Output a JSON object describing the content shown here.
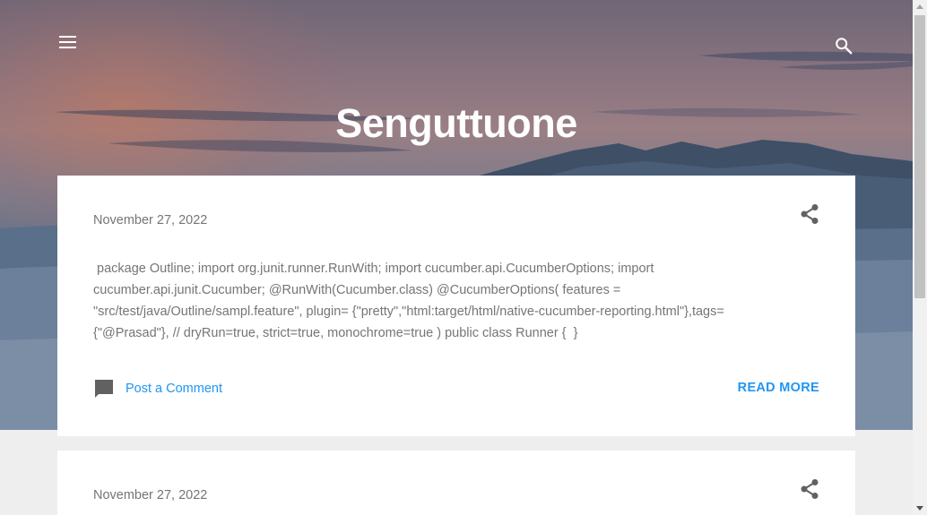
{
  "blog": {
    "title": "Senguttuone"
  },
  "header": {
    "menu_icon": "hamburger-menu-icon",
    "search_icon": "search-icon"
  },
  "posts": [
    {
      "date": "November 27, 2022",
      "snippet": " package Outline; import org.junit.runner.RunWith; import cucumber.api.CucumberOptions; import cucumber.api.junit.Cucumber; @RunWith(Cucumber.class) @CucumberOptions( features = \"src/test/java/Outline/sampl.feature\", plugin= {\"pretty\",\"html:target/html/native-cucumber-reporting.html\"},tags= {\"@Prasad\"}, // dryRun=true, strict=true, monochrome=true ) public class Runner {  }",
      "comment_label": "Post a Comment",
      "read_more_label": "READ MORE"
    },
    {
      "date": "November 27, 2022"
    }
  ],
  "colors": {
    "accent": "#2196f3",
    "meta_text": "#757575",
    "page_bg": "#eeeeee"
  }
}
